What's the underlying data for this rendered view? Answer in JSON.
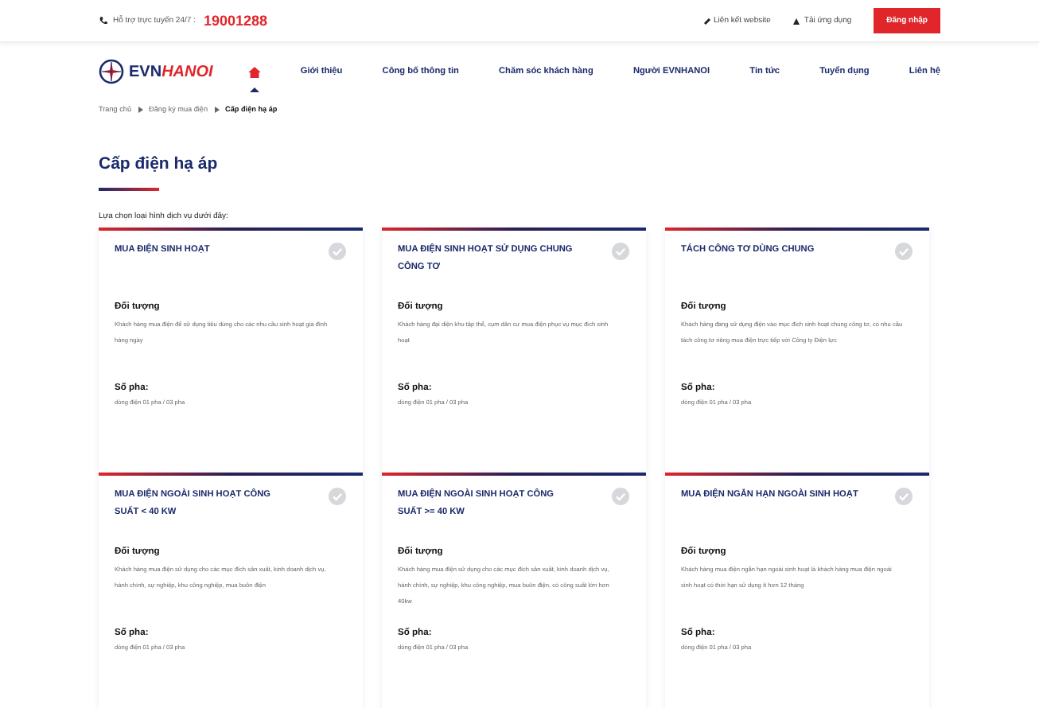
{
  "topbar": {
    "hotline_label": "Hỗ trợ trực tuyến 24/7 :",
    "hotline_number": "19001288",
    "links": [
      "Liên kết website",
      "Tải ứng dụng"
    ],
    "login": "Đăng nhập"
  },
  "header": {
    "logo_prefix": "EVN",
    "logo_suffix": "HANOI",
    "nav": [
      {
        "label": "Giới thiệu",
        "selected": false
      },
      {
        "label": "Công bố thông tin",
        "selected": false
      },
      {
        "label": "Chăm sóc khách hàng",
        "selected": false
      },
      {
        "label": "Người EVNHANOI",
        "selected": false
      },
      {
        "label": "Tin tức",
        "selected": false
      },
      {
        "label": "Tuyển dụng",
        "selected": false
      },
      {
        "label": "Liên hệ",
        "selected": false
      }
    ],
    "home_selected": true
  },
  "breadcrumb": [
    "Trang chủ",
    "Đăng ký mua điện",
    "Cấp điện hạ áp"
  ],
  "title": "Cấp điện hạ áp",
  "intro": "Lựa chọn loại hình dịch vụ dưới đây:",
  "services": [
    {
      "name": "MUA ĐIỆN SINH HOẠT",
      "checked": false,
      "object_label": "Đối tượng",
      "object": "Khách hàng mua điện để sử dụng tiêu dùng cho các nhu cầu sinh hoạt gia đình hàng ngày",
      "phase_label": "Số pha:",
      "phase": "dòng điện 01 pha / 03 pha"
    },
    {
      "name": "MUA ĐIỆN SINH HOẠT SỬ DỤNG CHUNG CÔNG TƠ",
      "checked": false,
      "object_label": "Đối tượng",
      "object": "Khách hàng đại diện khu tập thể, cụm dân cư mua điện phục vụ mục đích sinh hoạt",
      "phase_label": "Số pha:",
      "phase": "dòng điện 01 pha / 03 pha"
    },
    {
      "name": "TÁCH CÔNG TƠ DÙNG CHUNG",
      "checked": false,
      "object_label": "Đối tượng",
      "object": "Khách hàng đang sử dụng điện vào mục đích sinh hoạt chung công tơ, có nhu cầu tách công tơ riêng mua điện trực tiếp với Công ty Điện lực",
      "phase_label": "Số pha:",
      "phase": "dòng điện 01 pha / 03 pha"
    },
    {
      "name": "MUA ĐIỆN NGOÀI SINH HOẠT CÔNG SUẤT < 40 KW",
      "checked": false,
      "object_label": "Đối tượng",
      "object": "Khách hàng mua điện sử dụng cho các mục đích sản xuất, kinh doanh dịch vụ, hành chính, sự nghiệp, khu công nghiệp, mua buôn điện",
      "phase_label": "Số pha:",
      "phase": "dòng điện 01 pha / 03 pha"
    },
    {
      "name": "MUA ĐIỆN NGOÀI SINH HOẠT CÔNG SUẤT >= 40 KW",
      "checked": false,
      "object_label": "Đối tượng",
      "object": "Khách hàng mua điện sử dụng cho các mục đích sản xuất, kinh doanh dịch vụ, hành chính, sự nghiệp, khu công nghiệp, mua buôn điện, có công suất lớn hơn 40kw",
      "phase_label": "Số pha:",
      "phase": "dòng điện 01 pha / 03 pha"
    },
    {
      "name": "MUA ĐIỆN NGẮN HẠN NGOÀI SINH HOẠT",
      "checked": false,
      "object_label": "Đối tượng",
      "object": "Khách hàng mua điện ngắn hạn ngoài sinh hoạt là khách hàng mua điện ngoài sinh hoạt có thời hạn sử dụng ít hơn 12 tháng",
      "phase_label": "Số pha:",
      "phase": "dòng điện 01 pha / 03 pha"
    }
  ]
}
